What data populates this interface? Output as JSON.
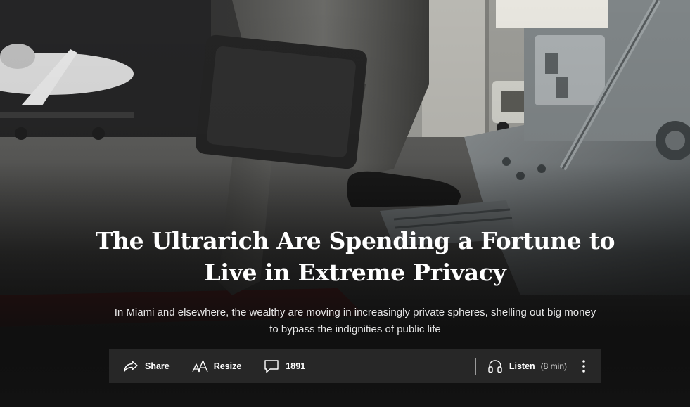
{
  "article": {
    "headline": "The Ultrarich Are Spending a Fortune to Live in Extreme Privacy",
    "dek": "In Miami and elsewhere, the wealthy are moving in increasingly private spheres, shelling out big money to bypass the indignities of public life"
  },
  "toolbar": {
    "share_label": "Share",
    "resize_label": "Resize",
    "comments_count": "1891",
    "listen_label": "Listen",
    "listen_duration": "(8 min)",
    "icons": {
      "share": "share-arrow-icon",
      "resize": "text-resize-icon",
      "comments": "comment-bubble-icon",
      "listen": "headphones-icon",
      "more": "more-vertical-icon"
    }
  },
  "colors": {
    "toolbar_background": "#272727",
    "headline_text": "#ffffff",
    "dek_text": "#e6e6e6",
    "page_background": "#141414"
  }
}
